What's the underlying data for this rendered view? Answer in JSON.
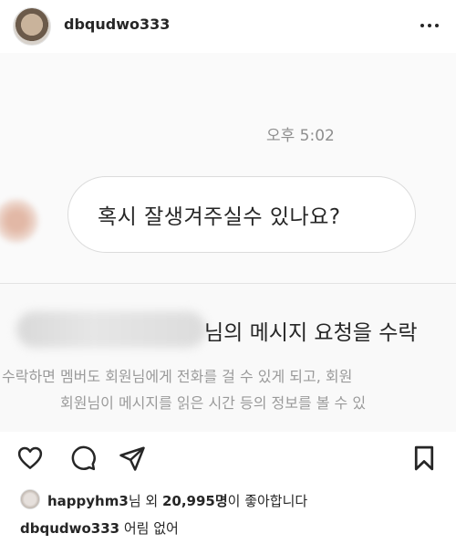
{
  "header": {
    "username": "dbqudwo333",
    "more_icon": "more-horizontal-icon"
  },
  "post_image": {
    "timestamp": "오후 5:02",
    "message_bubble": "혹시 잘생겨주실수 있나요?",
    "request_title": "님의 메시지 요청을 수락",
    "request_line1": "수락하면 멤버도 회원님에게 전화를 걸 수 있게 되고, 회원",
    "request_line2": "회원님이 메시지를 읽은 시간 등의 정보를 볼 수 있"
  },
  "actions": {
    "icons": [
      "heart-icon",
      "comment-icon",
      "share-icon",
      "bookmark-icon"
    ]
  },
  "likes": {
    "liker": "happyhm3",
    "suffix1": "님 외 ",
    "count": "20,995명",
    "suffix2": "이 좋아합니다"
  },
  "caption": {
    "username": "dbqudwo333",
    "text": " 어림 없어"
  }
}
